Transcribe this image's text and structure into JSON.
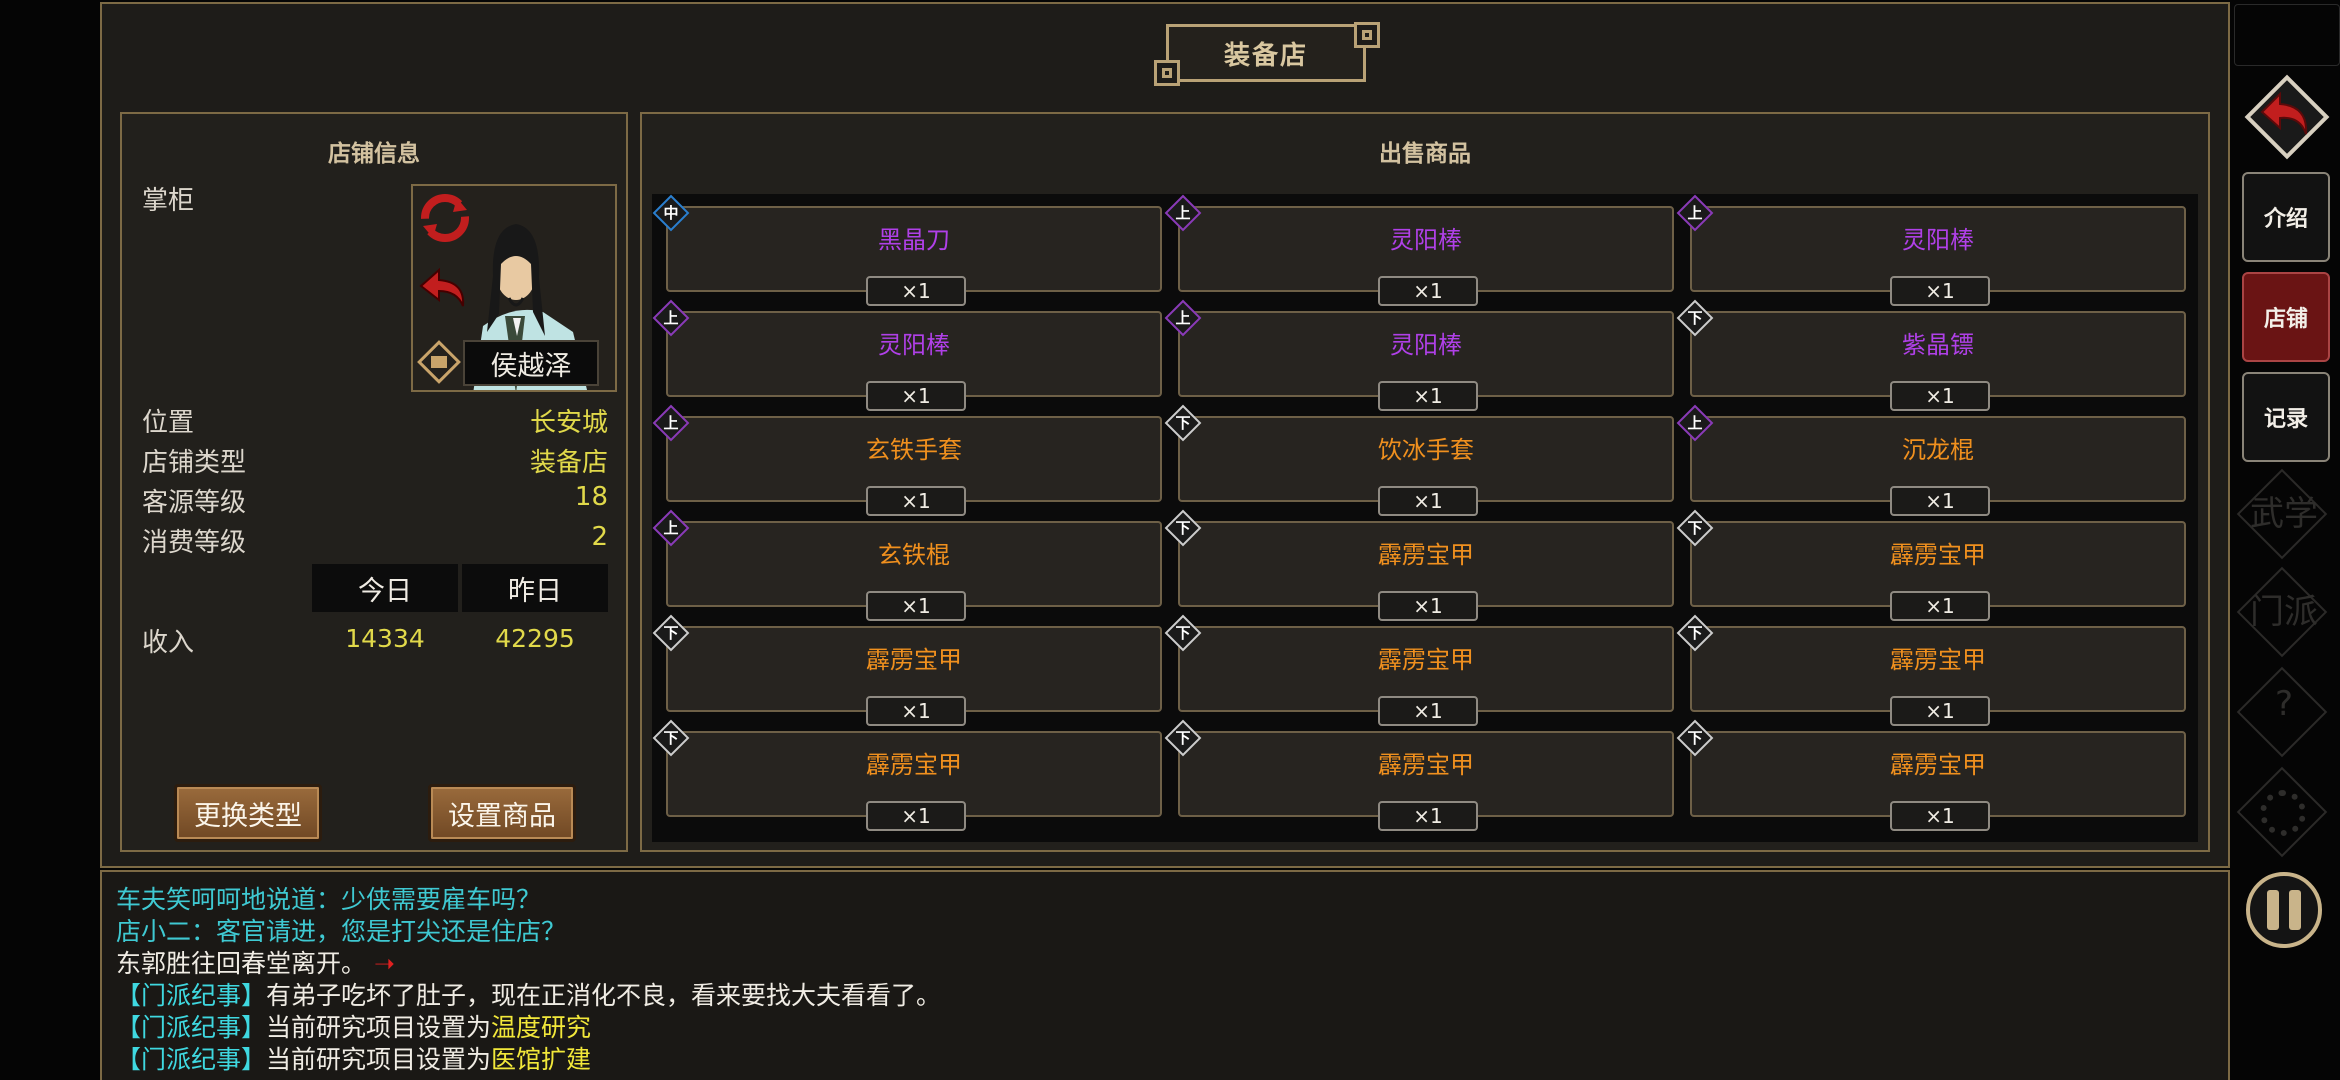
{
  "title": "装备店",
  "shop_info": {
    "heading": "店铺信息",
    "keeper_label": "掌柜",
    "keeper_name": "侯越泽",
    "rows": [
      {
        "label": "位置",
        "value": "长安城"
      },
      {
        "label": "店铺类型",
        "value": "装备店"
      },
      {
        "label": "客源等级",
        "value": "18"
      },
      {
        "label": "消费等级",
        "value": "2"
      }
    ],
    "today_label": "今日",
    "yesterday_label": "昨日",
    "income_label": "收入",
    "income_today": "14334",
    "income_yesterday": "42295",
    "change_type_label": "更换类型",
    "set_goods_label": "设置商品"
  },
  "goods": {
    "heading": "出售商品",
    "items": [
      {
        "name": "黑晶刀",
        "qty": "×1",
        "grade": "中",
        "name_color": "#b040e8",
        "badge_color": "#2a7fd0"
      },
      {
        "name": "灵阳棒",
        "qty": "×1",
        "grade": "上",
        "name_color": "#b040e8",
        "badge_color": "#8a3ab8"
      },
      {
        "name": "灵阳棒",
        "qty": "×1",
        "grade": "上",
        "name_color": "#b040e8",
        "badge_color": "#8a3ab8"
      },
      {
        "name": "灵阳棒",
        "qty": "×1",
        "grade": "上",
        "name_color": "#b040e8",
        "badge_color": "#8a3ab8"
      },
      {
        "name": "灵阳棒",
        "qty": "×1",
        "grade": "上",
        "name_color": "#b040e8",
        "badge_color": "#8a3ab8"
      },
      {
        "name": "紫晶镖",
        "qty": "×1",
        "grade": "下",
        "name_color": "#b040e8",
        "badge_color": "#cccccc"
      },
      {
        "name": "玄铁手套",
        "qty": "×1",
        "grade": "上",
        "name_color": "#f0901e",
        "badge_color": "#8a3ab8"
      },
      {
        "name": "饮冰手套",
        "qty": "×1",
        "grade": "下",
        "name_color": "#f0901e",
        "badge_color": "#cccccc"
      },
      {
        "name": "沉龙棍",
        "qty": "×1",
        "grade": "上",
        "name_color": "#f0901e",
        "badge_color": "#8a3ab8"
      },
      {
        "name": "玄铁棍",
        "qty": "×1",
        "grade": "上",
        "name_color": "#f0901e",
        "badge_color": "#8a3ab8"
      },
      {
        "name": "霹雳宝甲",
        "qty": "×1",
        "grade": "下",
        "name_color": "#f0901e",
        "badge_color": "#cccccc"
      },
      {
        "name": "霹雳宝甲",
        "qty": "×1",
        "grade": "下",
        "name_color": "#f0901e",
        "badge_color": "#cccccc"
      },
      {
        "name": "霹雳宝甲",
        "qty": "×1",
        "grade": "下",
        "name_color": "#f0901e",
        "badge_color": "#cccccc"
      },
      {
        "name": "霹雳宝甲",
        "qty": "×1",
        "grade": "下",
        "name_color": "#f0901e",
        "badge_color": "#cccccc"
      },
      {
        "name": "霹雳宝甲",
        "qty": "×1",
        "grade": "下",
        "name_color": "#f0901e",
        "badge_color": "#cccccc"
      },
      {
        "name": "霹雳宝甲",
        "qty": "×1",
        "grade": "下",
        "name_color": "#f0901e",
        "badge_color": "#cccccc"
      },
      {
        "name": "霹雳宝甲",
        "qty": "×1",
        "grade": "下",
        "name_color": "#f0901e",
        "badge_color": "#cccccc"
      },
      {
        "name": "霹雳宝甲",
        "qty": "×1",
        "grade": "下",
        "name_color": "#f0901e",
        "badge_color": "#cccccc"
      }
    ]
  },
  "log": {
    "line1": "车夫笑呵呵地说道：少侠需要雇车吗？",
    "line2": "店小二：客官请进，您是打尖还是住店？",
    "line3": "东郭胜往回春堂离开。",
    "tag": "【门派纪事】",
    "line4_text": "有弟子吃坏了肚子，现在正消化不良，看来要找大夫看看了。",
    "line5_prefix": "当前研究项目设置为",
    "line5_highlight": "温度研究",
    "line6_prefix": "当前研究项目设置为",
    "line6_highlight": "医馆扩建"
  },
  "side_nav": {
    "intro_label": "介绍",
    "shop_label": "店铺",
    "record_label": "记录",
    "wuxue_label": "武学",
    "menpai_label": "门派",
    "help_label": "?"
  },
  "colors": {
    "accent_gold": "#e1d94a",
    "frame_brown": "#7d6a45",
    "log_cyan": "#3fd8e0",
    "active_tab": "#6a1414"
  }
}
